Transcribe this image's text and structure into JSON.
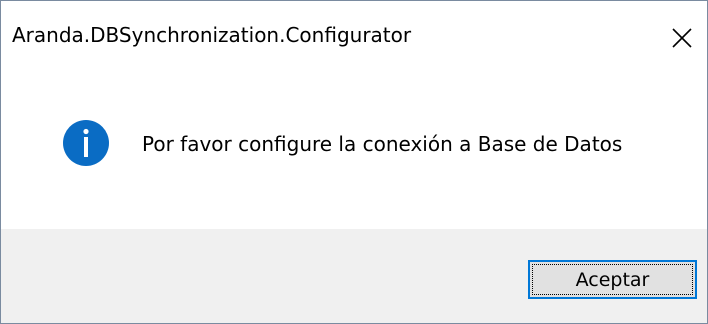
{
  "window": {
    "title": "Aranda.DBSynchronization.Configurator",
    "close_icon": "close-icon"
  },
  "message": {
    "icon": "info-icon",
    "icon_color": "#0a6cc4",
    "text": "Por favor configure la conexión a Base de Datos"
  },
  "buttons": {
    "ok_label": "Aceptar",
    "focus_color": "#0078d7"
  }
}
